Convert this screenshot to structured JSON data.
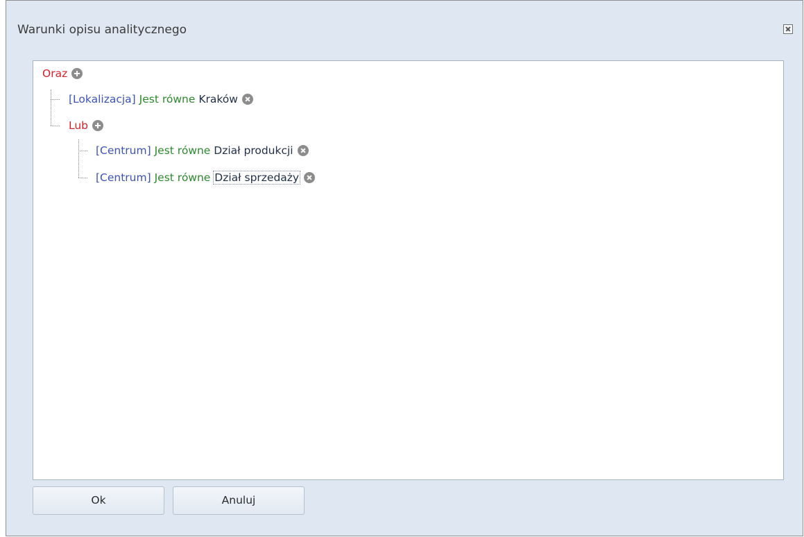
{
  "window": {
    "title": "Warunki opisu analitycznego"
  },
  "tree": {
    "root": {
      "operator": "Oraz",
      "action_icon": "plus-icon"
    },
    "children": [
      {
        "field": "[Lokalizacja]",
        "comparator": "Jest równe",
        "value": "Kraków",
        "action_icon": "remove-icon"
      },
      {
        "operator": "Lub",
        "action_icon": "plus-icon",
        "children": [
          {
            "field": "[Centrum]",
            "comparator": "Jest równe",
            "value": "Dział produkcji",
            "action_icon": "remove-icon"
          },
          {
            "field": "[Centrum]",
            "comparator": "Jest równe",
            "value": "Dział sprzedaży",
            "action_icon": "remove-icon"
          }
        ]
      }
    ]
  },
  "buttons": {
    "ok_label": "Ok",
    "cancel_label": "Anuluj"
  },
  "colors": {
    "operator": "#d4202a",
    "field": "#3b52b8",
    "comparator": "#2c8a2c",
    "value": "#1f2f4a",
    "dialog_background": "#dee7f2"
  }
}
